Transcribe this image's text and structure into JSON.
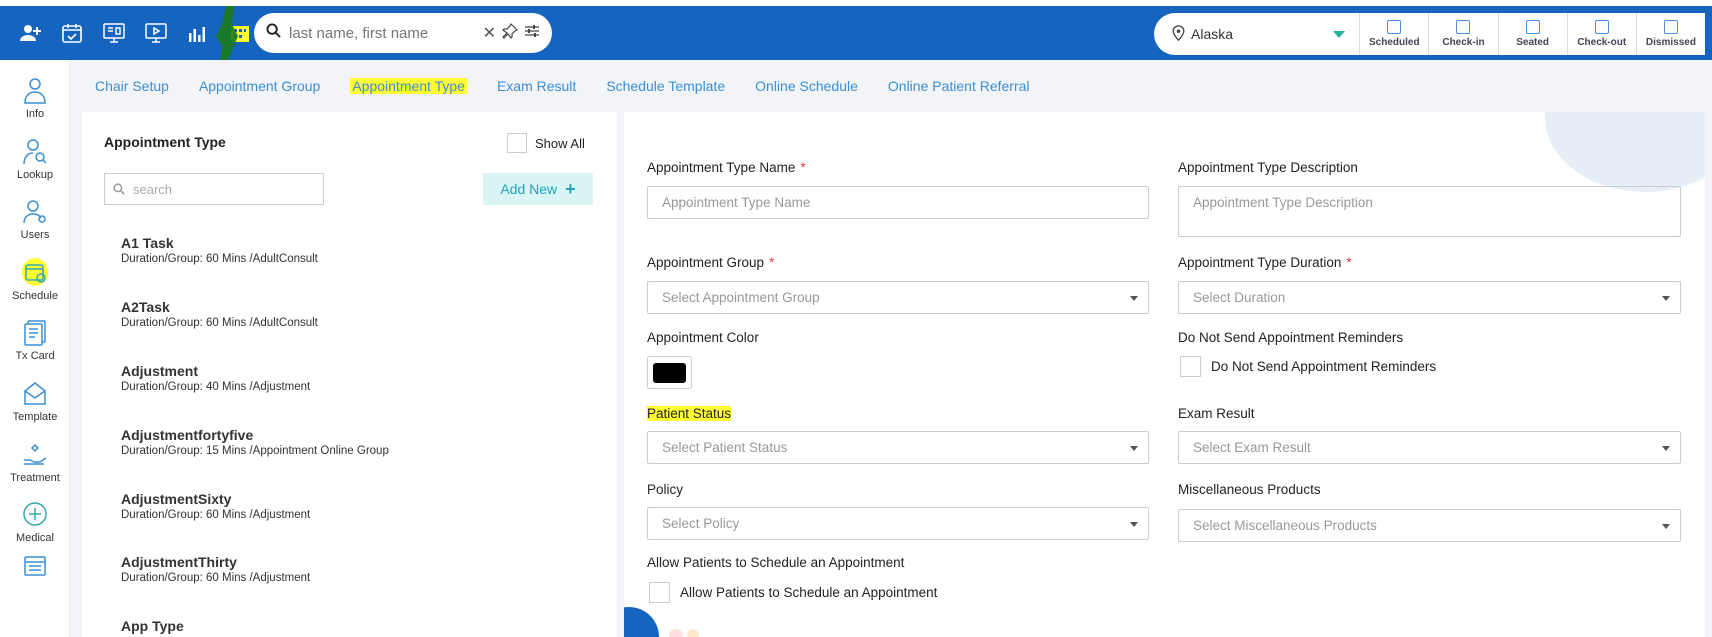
{
  "search": {
    "placeholder": "last name, first name"
  },
  "location": {
    "name": "Alaska"
  },
  "statuses": [
    "Scheduled",
    "Check-in",
    "Seated",
    "Check-out",
    "Dismissed"
  ],
  "sidebar": {
    "items": [
      {
        "label": "Info"
      },
      {
        "label": "Lookup"
      },
      {
        "label": "Users"
      },
      {
        "label": "Schedule"
      },
      {
        "label": "Tx Card"
      },
      {
        "label": "Template"
      },
      {
        "label": "Treatment"
      },
      {
        "label": "Medical"
      }
    ]
  },
  "tabs": [
    {
      "label": "Chair Setup"
    },
    {
      "label": "Appointment Group"
    },
    {
      "label": "Appointment Type"
    },
    {
      "label": "Exam Result"
    },
    {
      "label": "Schedule Template"
    },
    {
      "label": "Online Schedule"
    },
    {
      "label": "Online Patient Referral"
    }
  ],
  "list": {
    "title": "Appointment Type",
    "show_all": "Show All",
    "search_placeholder": "search",
    "add_new": "Add New",
    "items": [
      {
        "name": "A1 Task",
        "sub": "Duration/Group: 60 Mins /AdultConsult"
      },
      {
        "name": "A2Task",
        "sub": "Duration/Group: 60 Mins /AdultConsult"
      },
      {
        "name": "Adjustment",
        "sub": "Duration/Group: 40 Mins /Adjustment"
      },
      {
        "name": "Adjustmentfortyfive",
        "sub": "Duration/Group: 15 Mins /Appointment Online Group"
      },
      {
        "name": "AdjustmentSixty",
        "sub": "Duration/Group: 60 Mins /Adjustment"
      },
      {
        "name": "AdjustmentThirty",
        "sub": "Duration/Group: 60 Mins /Adjustment"
      },
      {
        "name": "App Type",
        "sub": ""
      }
    ]
  },
  "form": {
    "type_name_label": "Appointment Type Name",
    "type_name_placeholder": "Appointment Type Name",
    "type_desc_label": "Appointment Type Description",
    "type_desc_placeholder": "Appointment Type Description",
    "group_label": "Appointment Group",
    "group_placeholder": "Select Appointment Group",
    "duration_label": "Appointment Type Duration",
    "duration_placeholder": "Select Duration",
    "color_label": "Appointment Color",
    "reminders_label": "Do Not Send Appointment Reminders",
    "reminders_checkbox": "Do Not Send Appointment Reminders",
    "patient_status_label": "Patient Status",
    "patient_status_placeholder": "Select Patient Status",
    "exam_result_label": "Exam Result",
    "exam_result_placeholder": "Select Exam Result",
    "policy_label": "Policy",
    "policy_placeholder": "Select Policy",
    "misc_label": "Miscellaneous Products",
    "misc_placeholder": "Select Miscellaneous Products",
    "allow_label": "Allow Patients to Schedule an Appointment",
    "allow_checkbox": "Allow Patients to Schedule an Appointment",
    "color_value": "#000000"
  }
}
